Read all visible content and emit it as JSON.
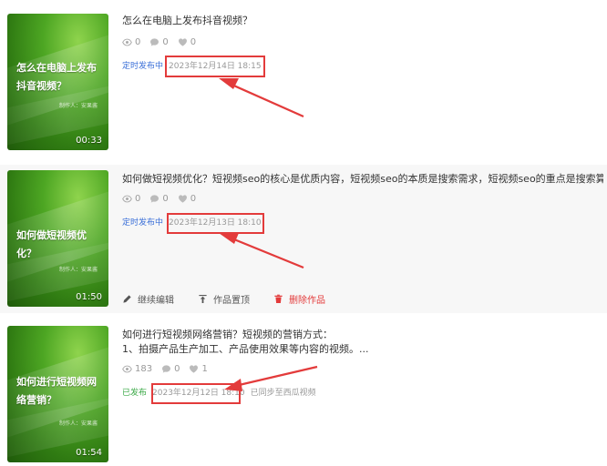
{
  "colors": {
    "accent_red": "#e33b3b",
    "scheduled_blue": "#3a6fd8",
    "published_green": "#39a845",
    "thumb_green": "#3f9a1a"
  },
  "videos": [
    {
      "thumb": {
        "title": "怎么在电脑上发布抖音视频？",
        "author": "制作人：安果酱",
        "duration": "00:33"
      },
      "title": "怎么在电脑上发布抖音视频？",
      "desc": "",
      "stats": {
        "views": "0",
        "comments": "0",
        "likes": "0"
      },
      "status": "定时发布中",
      "publish_time": "2023年12月14日 18:15",
      "extra_status": "",
      "actions": []
    },
    {
      "thumb": {
        "title": "如何做短视频优化？",
        "author": "制作人：安果酱",
        "duration": "01:50"
      },
      "title": "如何做短视频优化？短视频seo的核心是优质内容，短视频seo的本质是搜索需求，短视频seo的重点是搜索算法规则",
      "desc": "",
      "stats": {
        "views": "0",
        "comments": "0",
        "likes": "0"
      },
      "status": "定时发布中",
      "publish_time": "2023年12月13日 18:10",
      "extra_status": "",
      "actions": [
        "继续编辑",
        "作品置顶",
        "删除作品"
      ]
    },
    {
      "thumb": {
        "title": "如何进行短视频网络营销？",
        "author": "制作人：安果酱",
        "duration": "01:54"
      },
      "title": "如何进行短视频网络营销？短视频的营销方式：",
      "desc": "1、拍摄产品生产加工、产品使用效果等内容的视频。...",
      "stats": {
        "views": "183",
        "comments": "0",
        "likes": "1"
      },
      "status": "已发布",
      "publish_time": "2023年12月12日 18:10",
      "extra_status": "已同步至西瓜视频",
      "actions": []
    }
  ]
}
